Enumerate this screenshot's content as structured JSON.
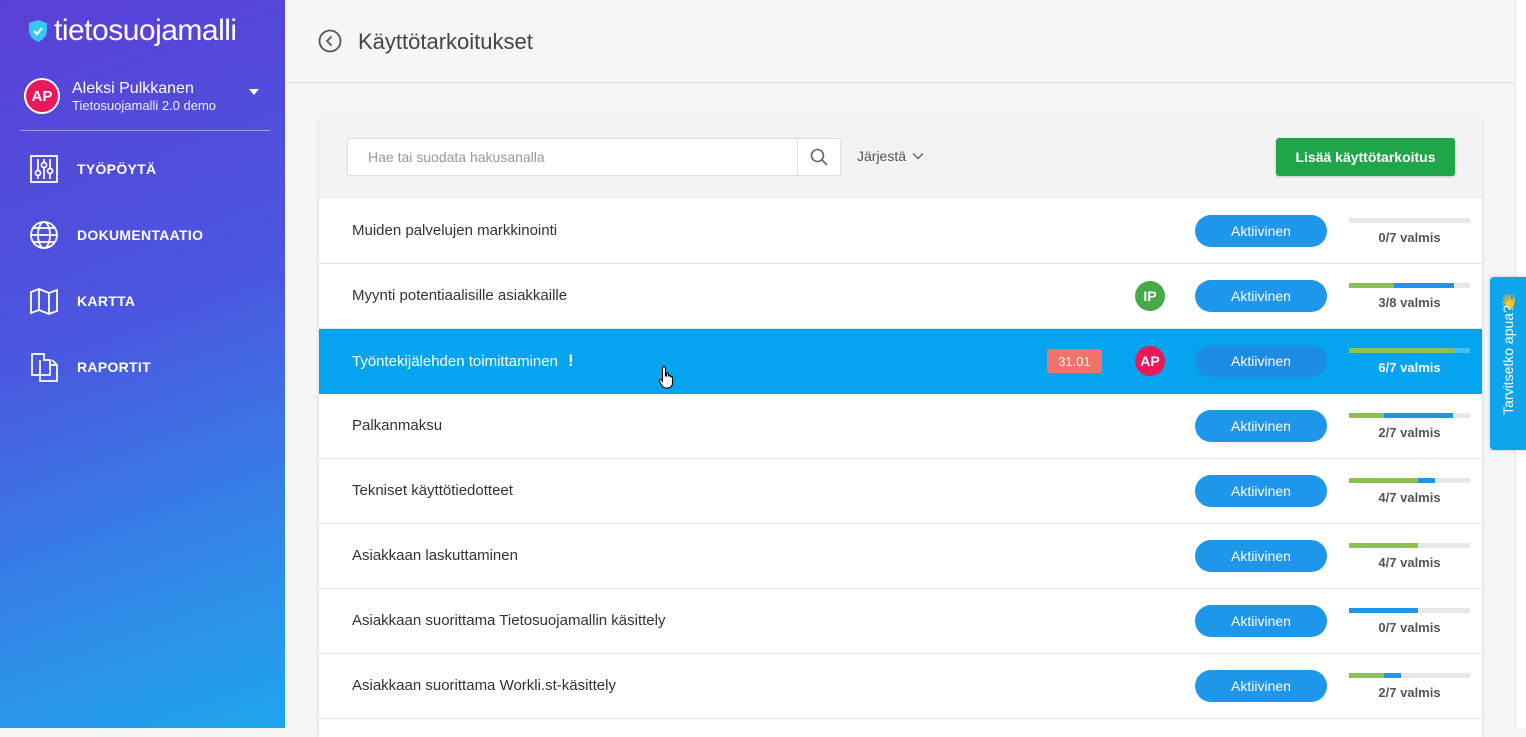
{
  "brand": {
    "name": "tietosuojamalli"
  },
  "user": {
    "initials": "AP",
    "name": "Aleksi Pulkkanen",
    "org": "Tietosuojamalli 2.0 demo"
  },
  "nav": [
    {
      "label": "TYÖPÖYTÄ",
      "icon": "sliders-icon"
    },
    {
      "label": "DOKUMENTAATIO",
      "icon": "globe-icon"
    },
    {
      "label": "KARTTA",
      "icon": "map-icon"
    },
    {
      "label": "RAPORTIT",
      "icon": "documents-icon"
    }
  ],
  "header": {
    "title": "Käyttötarkoitukset"
  },
  "toolbar": {
    "search_placeholder": "Hae tai suodata hakusanalla",
    "sort_label": "Järjestä",
    "add_label": "Lisää käyttötarkoitus"
  },
  "rows": [
    {
      "title": "Muiden palvelujen markkinointi",
      "status": "Aktiivinen",
      "progress_label": "0/7 valmis",
      "green": 0,
      "blue": 0,
      "selected": false
    },
    {
      "title": "Myynti potentiaalisille asiakkaille",
      "avatar": "IP",
      "avatar_color": "#46a94a",
      "status": "Aktiivinen",
      "progress_label": "3/8 valmis",
      "green": 0.37,
      "blue": 0.87,
      "selected": false
    },
    {
      "title": "Työntekijälehden toimittaminen",
      "warning": "!",
      "date": "31.01",
      "avatar": "AP",
      "avatar_color": "#e8185a",
      "status": "Aktiivinen",
      "progress_label": "6/7 valmis",
      "green": 0.86,
      "blue": 0.86,
      "selected": true
    },
    {
      "title": "Palkanmaksu",
      "status": "Aktiivinen",
      "progress_label": "2/7 valmis",
      "green": 0.29,
      "blue": 0.86,
      "selected": false
    },
    {
      "title": "Tekniset käyttötiedotteet",
      "status": "Aktiivinen",
      "progress_label": "4/7 valmis",
      "green": 0.57,
      "blue": 0.71,
      "selected": false
    },
    {
      "title": "Asiakkaan laskuttaminen",
      "status": "Aktiivinen",
      "progress_label": "4/7 valmis",
      "green": 0.57,
      "blue": 0.57,
      "selected": false
    },
    {
      "title": "Asiakkaan suorittama Tietosuojamallin käsittely",
      "status": "Aktiivinen",
      "progress_label": "0/7 valmis",
      "green": 0,
      "blue": 0.57,
      "selected": false
    },
    {
      "title": "Asiakkaan suorittama Workli.st-käsittely",
      "status": "Aktiivinen",
      "progress_label": "2/7 valmis",
      "green": 0.29,
      "blue": 0.43,
      "selected": false
    }
  ],
  "help": {
    "label": "Tarvitsetko apua?",
    "emoji": "👋"
  },
  "colors": {
    "green": "#8cc152",
    "blue": "#1e96ea",
    "selected_row": "#04a5ee",
    "add_button": "#1fa64a"
  }
}
